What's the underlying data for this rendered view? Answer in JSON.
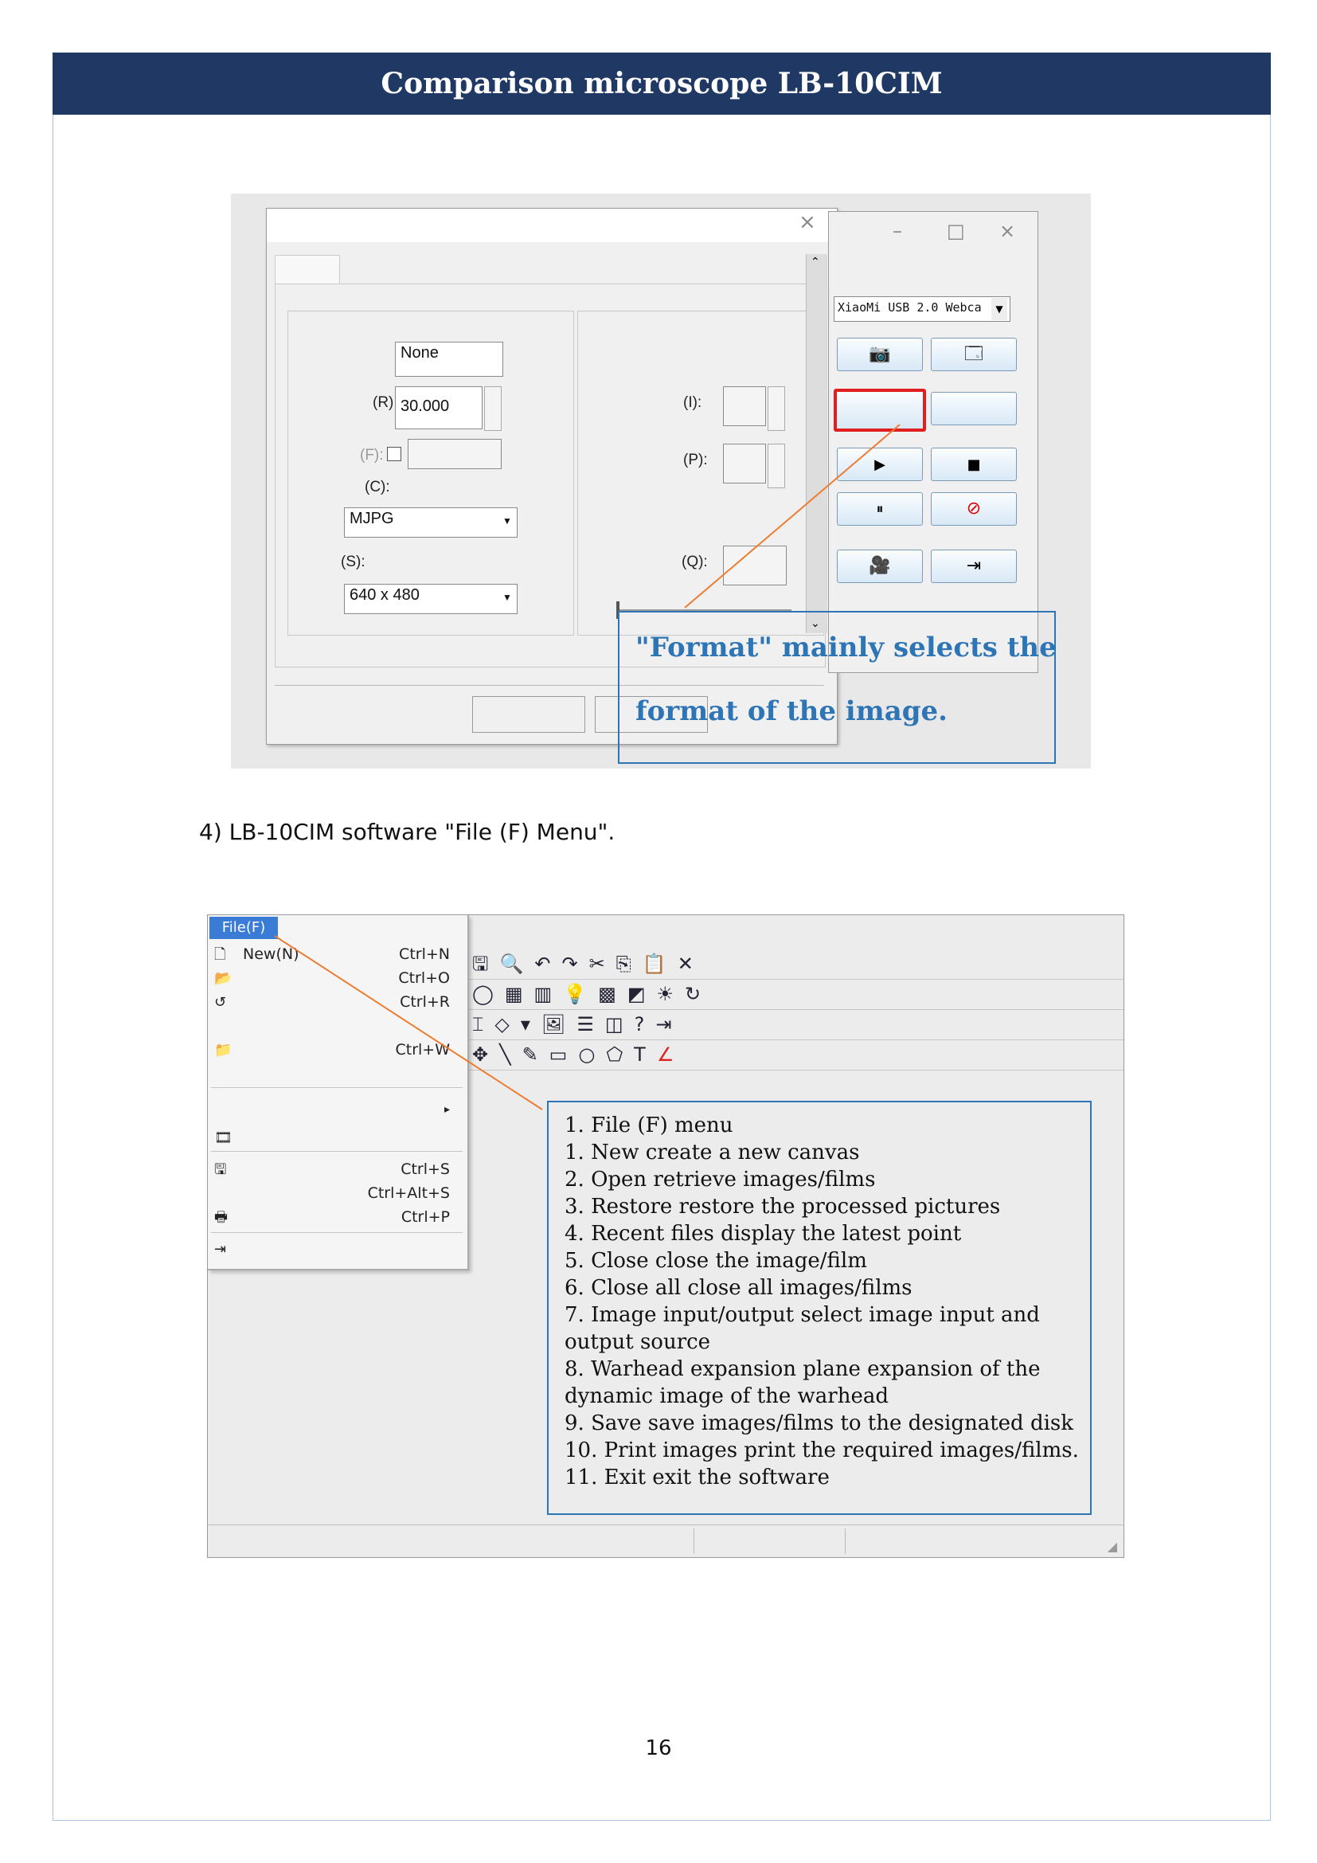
{
  "header": {
    "title": "Comparison microscope LB-10CIM"
  },
  "figure1": {
    "dialog": {
      "close_glyph": "×",
      "group_left": {
        "field_none": "None",
        "label_r": "(R):",
        "value_r": "30.000",
        "label_f": "(F):",
        "label_c": "(C):",
        "select_c": "MJPG",
        "label_s": "(S):",
        "select_s": "640 x 480"
      },
      "group_right": {
        "label_i": "(I):",
        "label_p": "(P):",
        "label_q": "(Q):"
      }
    },
    "camera_panel": {
      "device_select": "XiaoMi USB 2.0 Webca",
      "title_controls": [
        "–",
        "□",
        "×"
      ]
    },
    "callout": {
      "line1": "\"Format\" mainly selects the",
      "line2": "format of the image."
    }
  },
  "step": {
    "text": "4)   LB-10CIM software \"File (F) Menu\"."
  },
  "figure2": {
    "menu_title": "File(F)",
    "menu_items": [
      {
        "label": "New(N)",
        "shortcut": "Ctrl+N"
      },
      {
        "label": "",
        "shortcut": "Ctrl+O"
      },
      {
        "label": "",
        "shortcut": "Ctrl+R"
      },
      {
        "label": "",
        "shortcut": "Ctrl+W"
      },
      {
        "label": "",
        "shortcut": "Ctrl+S"
      },
      {
        "label": "",
        "shortcut": "Ctrl+Alt+S"
      },
      {
        "label": "",
        "shortcut": "Ctrl+P"
      }
    ],
    "info_lines": [
      "1. File (F) menu",
      "1. New        create a new canvas",
      "2. Open       retrieve images/films",
      "3. Restore       restore the processed pictures",
      "4. Recent files       display the latest point",
      "5. Close       close the image/film",
      "6. Close all       close all images/films",
      "7.  Image  input/output           select  image  input  and",
      "output source",
      "8.  Warhead  expansion           plane  expansion  of  the",
      "dynamic image of the warhead",
      "9. Save       save images/films to the designated disk",
      "10. Print images       print the required images/films.",
      "11. Exit       exit the software"
    ]
  },
  "footer": {
    "page_number": "16"
  }
}
